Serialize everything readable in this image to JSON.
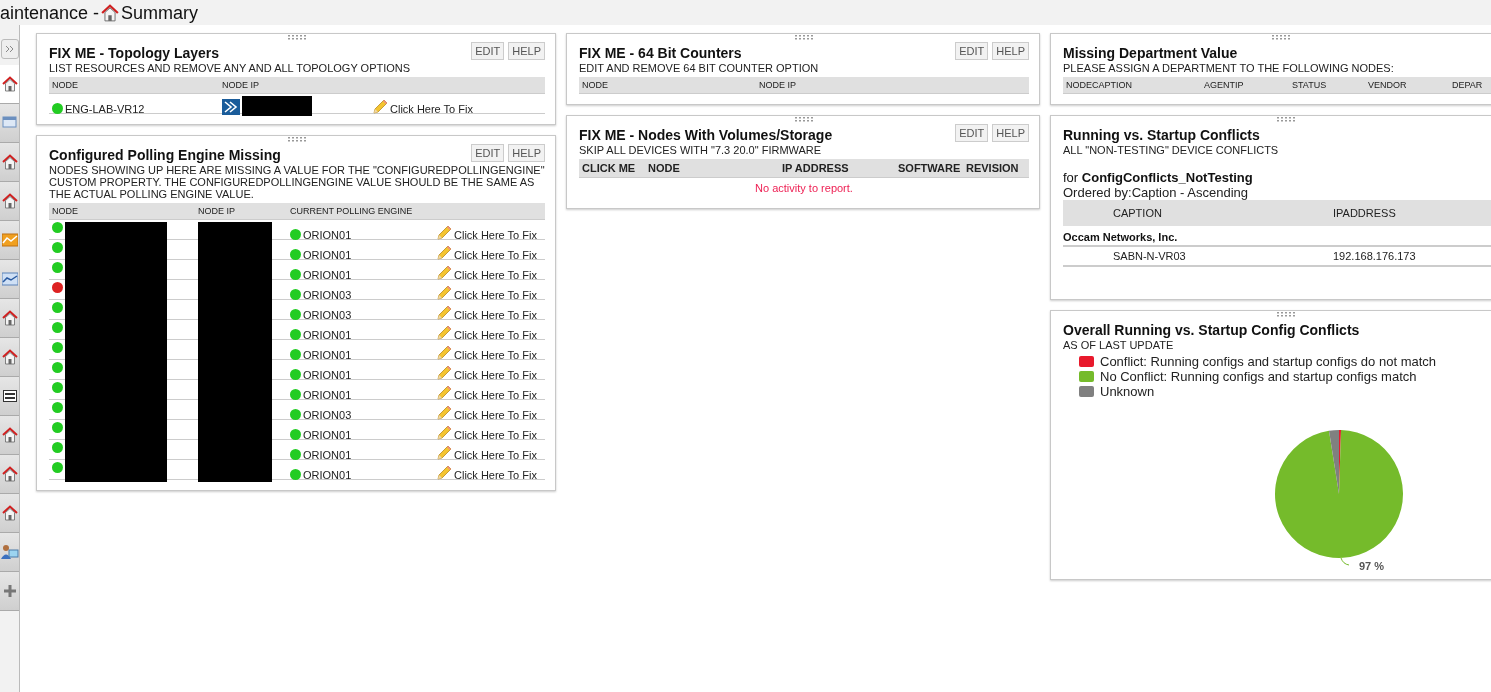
{
  "header": {
    "title_start": "aintenance - ",
    "title_end": "Summary"
  },
  "sidebar": {
    "items": [
      {
        "kind": "expand",
        "selected": false
      },
      {
        "kind": "home",
        "selected": true
      },
      {
        "kind": "window",
        "selected": false
      },
      {
        "kind": "home",
        "selected": false
      },
      {
        "kind": "home",
        "selected": false
      },
      {
        "kind": "chart",
        "selected": false
      },
      {
        "kind": "graph",
        "selected": false
      },
      {
        "kind": "home",
        "selected": false
      },
      {
        "kind": "home",
        "selected": false
      },
      {
        "kind": "panel",
        "selected": false
      },
      {
        "kind": "home",
        "selected": false
      },
      {
        "kind": "home",
        "selected": false
      },
      {
        "kind": "home",
        "selected": false
      },
      {
        "kind": "user",
        "selected": false
      },
      {
        "kind": "add",
        "selected": false
      }
    ]
  },
  "columns": [
    [
      {
        "kind": "fixtable",
        "title": "FIX ME - Topology Layers",
        "subtitle": "LIST RESOURCES AND REMOVE ANY AND ALL TOPOLOGY OPTIONS",
        "buttons": [
          "EDIT",
          "HELP"
        ],
        "headers": [
          "NODE",
          "NODE IP"
        ],
        "rows": [
          {
            "color": "#22cc22",
            "node": "ENG-LAB-VR12",
            "vendor_logo": true,
            "link": "Click Here To Fix"
          }
        ]
      },
      {
        "kind": "fixtable",
        "title": "Configured Polling Engine Missing",
        "subtitle": "NODES SHOWING UP HERE ARE MISSING A VALUE FOR THE \"CONFIGUREDPOLLINGENGINE\" CUSTOM PROPERTY. THE CONFIGUREDPOLLINGENGINE VALUE SHOULD BE THE SAME AS THE ACTUAL POLLING ENGINE VALUE.",
        "buttons": [
          "EDIT",
          "HELP"
        ],
        "headers": [
          "NODE",
          "NODE IP",
          "CURRENT POLLING ENGINE"
        ],
        "rows": [
          {
            "color": "#22cc22",
            "engine": "ORION01",
            "link": "Click Here To Fix"
          },
          {
            "color": "#22cc22",
            "engine": "ORION01",
            "link": "Click Here To Fix"
          },
          {
            "color": "#22cc22",
            "engine": "ORION01",
            "link": "Click Here To Fix"
          },
          {
            "color": "#dd2222",
            "engine": "ORION03",
            "link": "Click Here To Fix"
          },
          {
            "color": "#22cc22",
            "engine": "ORION03",
            "link": "Click Here To Fix"
          },
          {
            "color": "#22cc22",
            "engine": "ORION01",
            "link": "Click Here To Fix"
          },
          {
            "color": "#22cc22",
            "engine": "ORION01",
            "link": "Click Here To Fix"
          },
          {
            "color": "#22cc22",
            "engine": "ORION01",
            "link": "Click Here To Fix"
          },
          {
            "color": "#22cc22",
            "engine": "ORION01",
            "link": "Click Here To Fix"
          },
          {
            "color": "#22cc22",
            "engine": "ORION03",
            "link": "Click Here To Fix"
          },
          {
            "color": "#22cc22",
            "engine": "ORION01",
            "link": "Click Here To Fix"
          },
          {
            "color": "#22cc22",
            "engine": "ORION01",
            "link": "Click Here To Fix"
          },
          {
            "color": "#22cc22",
            "engine": "ORION01",
            "link": "Click Here To Fix"
          }
        ]
      }
    ],
    [
      {
        "kind": "fixtable",
        "title": "FIX ME - 64 Bit Counters",
        "subtitle": "EDIT AND REMOVE 64 BIT COUNTER OPTION",
        "buttons": [
          "EDIT",
          "HELP"
        ],
        "headers": [
          "NODE",
          "NODE IP"
        ]
      },
      {
        "kind": "fixtable",
        "title": "FIX ME - Nodes With Volumes/Storage",
        "subtitle": "SKIP ALL DEVICES WITH \"7.3 20.0\" FIRMWARE",
        "buttons": [
          "EDIT",
          "HELP"
        ],
        "headers": [
          "CLICK ME",
          "NODE",
          "IP ADDRESS",
          "SOFTWARE",
          "REVISION"
        ],
        "bold_headers": true,
        "empty": "No activity to report."
      }
    ],
    [
      {
        "kind": "fixtable",
        "title": "Missing Department Value",
        "subtitle": "PLEASE ASSIGN A DEPARTMENT TO THE FOLLOWING NODES:",
        "headers": [
          "NODECAPTION",
          "AGENTIP",
          "STATUS",
          "VENDOR",
          "DEPAR"
        ]
      },
      {
        "kind": "report",
        "title": "Running vs. Startup Conflicts",
        "subtitle": "ALL \"NON-TESTING\" DEVICE CONFLICTS",
        "for_label": "for ",
        "report_name": "ConfigConflicts_NotTesting",
        "ordered": "Ordered by:Caption - Ascending",
        "headers": [
          "CAPTION",
          "IPADDRESS"
        ],
        "group": "Occam Networks, Inc.",
        "rows": [
          {
            "caption": "SABN-N-VR03",
            "ip": "192.168.176.173"
          }
        ]
      },
      {
        "kind": "pie",
        "title": "Overall Running vs. Startup Config Conflicts",
        "subtitle": "AS OF LAST UPDATE",
        "chart_data": {
          "type": "pie",
          "categories": [
            "Conflict: Running configs and startup configs do not match",
            "No Conflict: Running configs and startup configs match",
            "Unknown"
          ],
          "series": [
            {
              "values": [
                0.5,
                97,
                2.5
              ]
            }
          ],
          "colors": [
            "#e8192c",
            "#75bb2b",
            "#808080"
          ],
          "value_labels": [
            "97 %"
          ]
        }
      }
    ]
  ]
}
